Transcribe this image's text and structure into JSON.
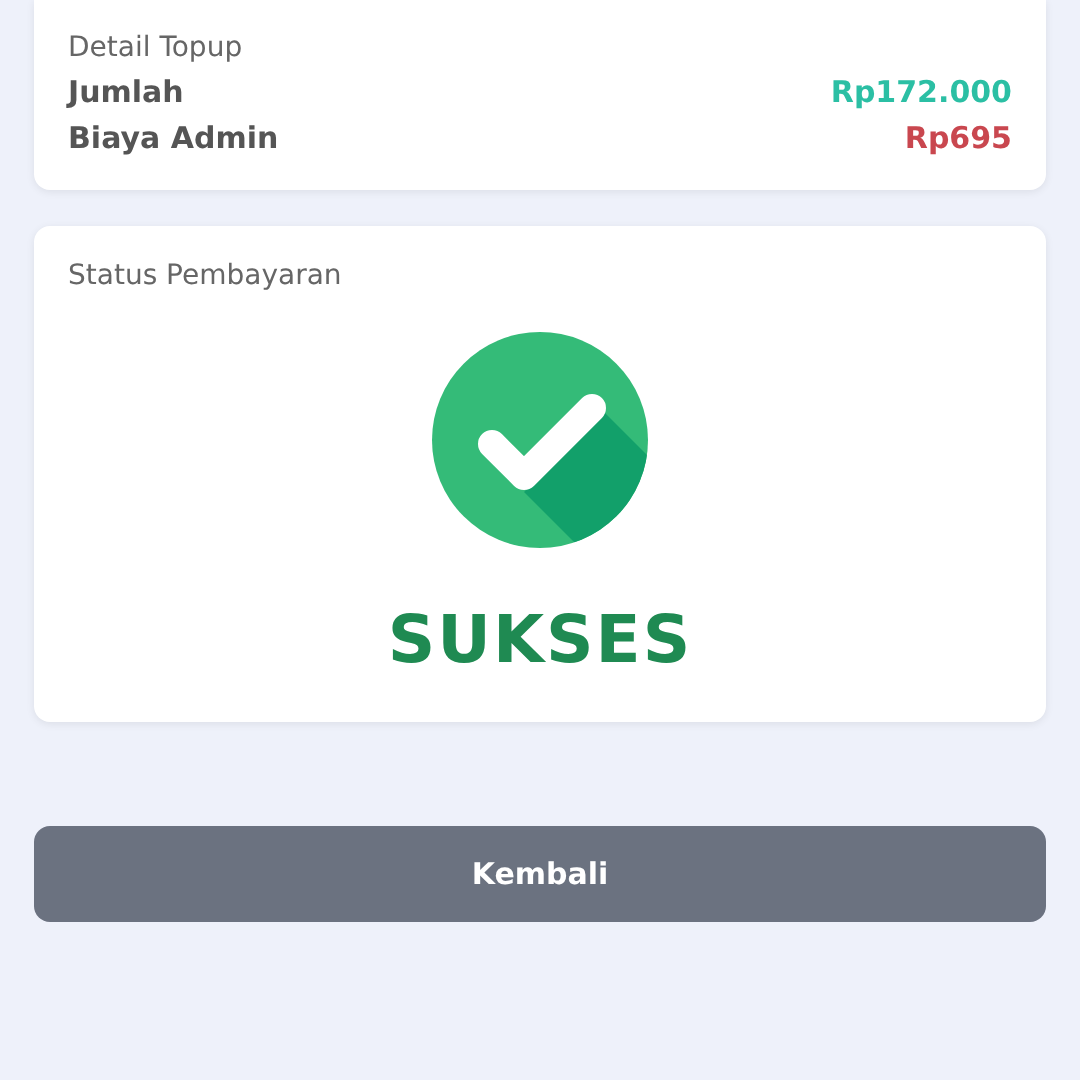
{
  "detail": {
    "title": "Detail Topup",
    "rows": [
      {
        "label": "Jumlah",
        "value": "Rp172.000",
        "kind": "amount"
      },
      {
        "label": "Biaya Admin",
        "value": "Rp695",
        "kind": "fee"
      }
    ]
  },
  "status": {
    "title": "Status Pembayaran",
    "kind": "success",
    "text": "SUKSES"
  },
  "button": {
    "label": "Kembali"
  }
}
